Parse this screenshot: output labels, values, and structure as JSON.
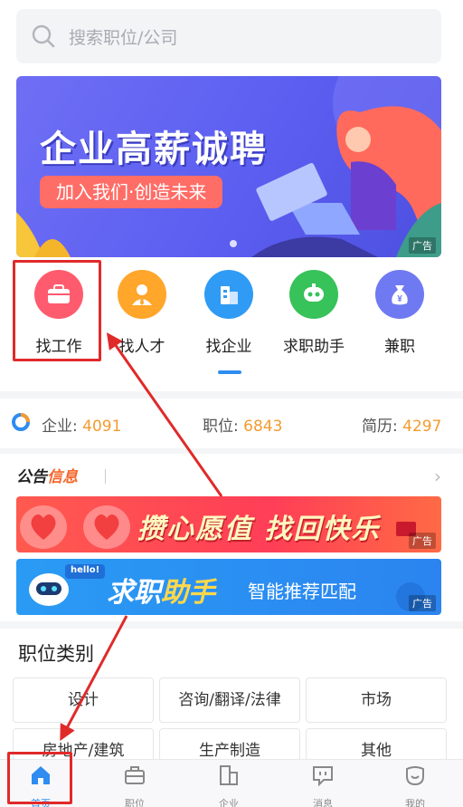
{
  "search": {
    "placeholder": "搜索职位/公司"
  },
  "banner": {
    "title": "企业高薪诚聘",
    "subtitle": "加入我们·创造未来",
    "ad_tag": "广告"
  },
  "categories": [
    {
      "label": "找工作",
      "icon": "briefcase-icon",
      "color": "#ff5b6e"
    },
    {
      "label": "找人才",
      "icon": "person-icon",
      "color": "#ffa62b"
    },
    {
      "label": "找企业",
      "icon": "building-icon",
      "color": "#2f9bf5"
    },
    {
      "label": "求职助手",
      "icon": "robot-icon",
      "color": "#37c25a"
    },
    {
      "label": "兼职",
      "icon": "money-bag-icon",
      "color": "#6f79f2"
    }
  ],
  "stats": {
    "company_label": "企业:",
    "company_value": "4091",
    "job_label": "职位:",
    "job_value": "6843",
    "resume_label": "简历:",
    "resume_value": "4297"
  },
  "notice": {
    "title_a": "公告",
    "title_b": "信息",
    "ad1_text": "攒心愿值 找回快乐",
    "ad2_big_a": "求职",
    "ad2_big_b": "助手",
    "ad2_small": "智能推荐匹配",
    "ad2_badge": "hello!",
    "ad_tag": "广告"
  },
  "jobs": {
    "heading": "职位类别",
    "items": [
      "设计",
      "咨询/翻译/法律",
      "市场",
      "房地产/建筑",
      "生产制造",
      "其他"
    ]
  },
  "nav": {
    "items": [
      "首页",
      "职位",
      "企业",
      "消息",
      "我的"
    ],
    "active_color": "#2f8cf0"
  }
}
